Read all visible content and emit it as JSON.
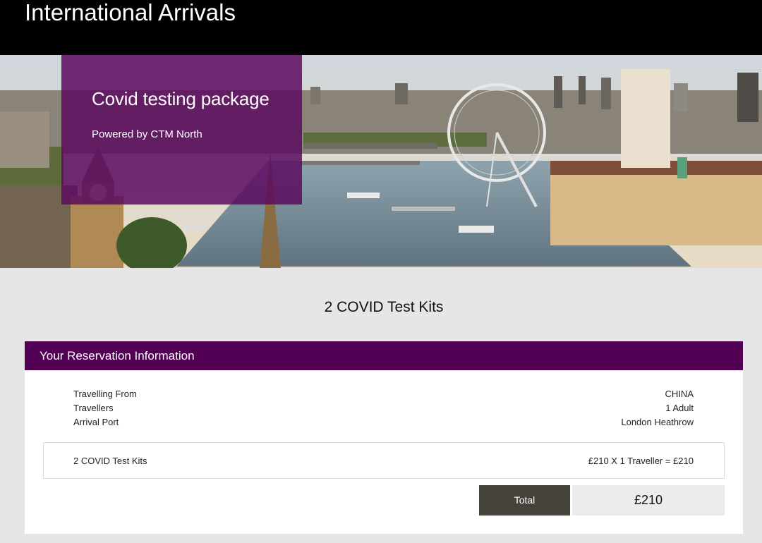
{
  "header": {
    "title": "International Arrivals"
  },
  "hero": {
    "title": "Covid testing package",
    "subtitle": "Powered by CTM North"
  },
  "section": {
    "title": "2 COVID Test Kits"
  },
  "reservation": {
    "heading": "Your Reservation Information",
    "rows": [
      {
        "label": "Travelling From",
        "value": "CHINA"
      },
      {
        "label": "Travellers",
        "value": "1 Adult"
      },
      {
        "label": "Arrival Port",
        "value": "London Heathrow"
      }
    ],
    "item": {
      "name": "2 COVID Test Kits",
      "calculation": "£210 X 1 Traveller = £210"
    },
    "total": {
      "label": "Total",
      "value": "£210"
    }
  },
  "colors": {
    "brand_purple": "#520053",
    "total_label_bg": "#46433d",
    "page_bg": "#e6e6e6"
  }
}
